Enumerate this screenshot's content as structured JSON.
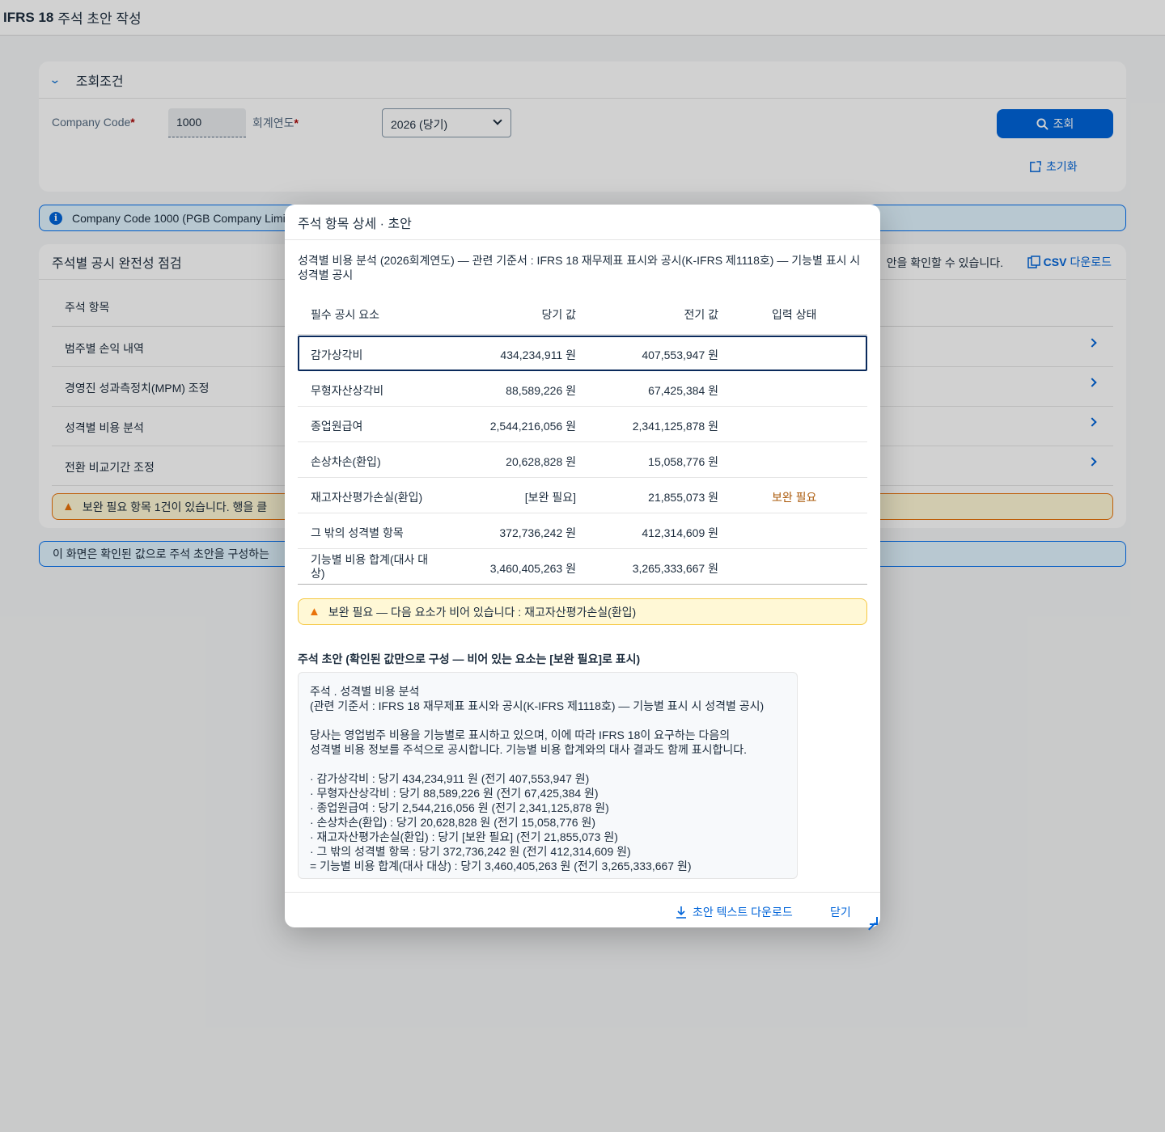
{
  "shell": {
    "title_bold": "IFRS 18",
    "title_rest": "주석 초안 작성"
  },
  "filter": {
    "header": "조회조건",
    "company_code_label": "Company Code",
    "company_code_value": "1000",
    "fiscal_year_label": "회계연도",
    "fiscal_year_value": "2026 (당기)",
    "required_mark": "*",
    "search_label": "조회",
    "reset_label": "초기화"
  },
  "info_strip": {
    "text": "Company Code 1000 (PGB Company Limit"
  },
  "list": {
    "header": "주석별 공시 완전성 점검",
    "header_tail": "안을 확인할 수 있습니다.",
    "csv_label": "CSV 다운로드",
    "column": "주석 항목",
    "rows": [
      "범주별 손익 내역",
      "경영진 성과측정치(MPM) 조정",
      "성격별 비용 분석",
      "전환 비교기간 조정"
    ],
    "warning": "보완 필요 항목 1건이 있습니다. 행을 클"
  },
  "info_strip2": {
    "text": "이 화면은 확인된 값으로 주석 초안을 구성하는"
  },
  "dialog": {
    "title": "주석 항목 상세 · 초안",
    "subtitle": "성격별 비용 분석 (2026회계연도) — 관련 기준서 : IFRS 18 재무제표 표시와 공시(K-IFRS 제1118호) — 기능별 표시 시 성격별 공시",
    "columns": {
      "element": "필수 공시 요소",
      "current": "당기 값",
      "prior": "전기 값",
      "status": "입력 상태"
    },
    "rows": [
      {
        "element": "감가상각비",
        "current": "434,234,911 원",
        "prior": "407,553,947 원",
        "status": ""
      },
      {
        "element": "무형자산상각비",
        "current": "88,589,226 원",
        "prior": "67,425,384 원",
        "status": ""
      },
      {
        "element": "종업원급여",
        "current": "2,544,216,056 원",
        "prior": "2,341,125,878 원",
        "status": ""
      },
      {
        "element": "손상차손(환입)",
        "current": "20,628,828 원",
        "prior": "15,058,776 원",
        "status": ""
      },
      {
        "element": "재고자산평가손실(환입)",
        "current": "[보완 필요]",
        "prior": "21,855,073 원",
        "status": "보완 필요"
      },
      {
        "element": "그 밖의 성격별 항목",
        "current": "372,736,242 원",
        "prior": "412,314,609 원",
        "status": ""
      },
      {
        "element": "기능별 비용 합계(대사 대상)",
        "current": "3,460,405,263 원",
        "prior": "3,265,333,667 원",
        "status": ""
      }
    ],
    "warning": "보완 필요 — 다음 요소가 비어 있습니다 : 재고자산평가손실(환입)",
    "draft_title": "주석 초안 (확인된 값만으로 구성 — 비어 있는 요소는 [보완 필요]로 표시)",
    "draft_text": "주석 . 성격별 비용 분석\n(관련 기준서 : IFRS 18 재무제표 표시와 공시(K-IFRS 제1118호) — 기능별 표시 시 성격별 공시)\n\n당사는 영업범주 비용을 기능별로 표시하고 있으며, 이에 따라 IFRS 18이 요구하는 다음의\n성격별 비용 정보를 주석으로 공시합니다. 기능별 비용 합계와의 대사 결과도 함께 표시합니다.\n\n· 감가상각비 : 당기 434,234,911 원 (전기 407,553,947 원)\n· 무형자산상각비 : 당기 88,589,226 원 (전기 67,425,384 원)\n· 종업원급여 : 당기 2,544,216,056 원 (전기 2,341,125,878 원)\n· 손상차손(환입) : 당기 20,628,828 원 (전기 15,058,776 원)\n· 재고자산평가손실(환입) : 당기 [보완 필요] (전기 21,855,073 원)\n· 그 밖의 성격별 항목 : 당기 372,736,242 원 (전기 412,314,609 원)\n= 기능별 비용 합계(대사 대상) : 당기 3,460,405,263 원 (전기 3,265,333,667 원)",
    "download_label": "초안 텍스트 다운로드",
    "close_label": "닫기"
  },
  "colors": {
    "accent": "#0064d9",
    "warning": "#e9730c",
    "need": "#aa5808"
  }
}
